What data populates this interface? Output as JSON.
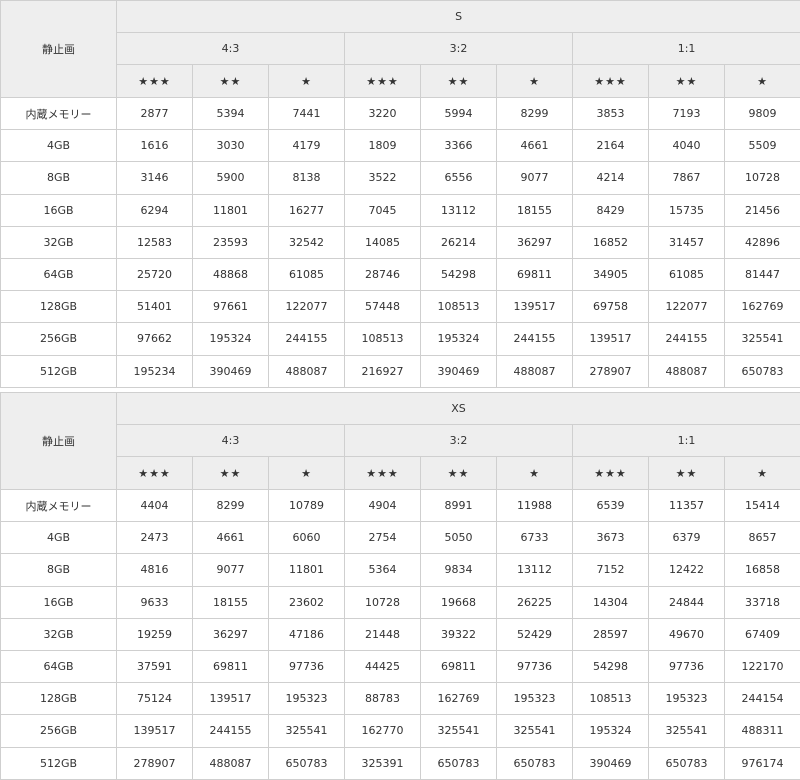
{
  "tables": [
    {
      "corner_label": "静止画",
      "size_label": "S",
      "ratios": [
        "4:3",
        "3:2",
        "1:1"
      ],
      "qualities": [
        "★★★",
        "★★",
        "★"
      ],
      "rows": [
        {
          "label": "内蔵メモリー",
          "values": [
            "2877",
            "5394",
            "7441",
            "3220",
            "5994",
            "8299",
            "3853",
            "7193",
            "9809"
          ]
        },
        {
          "label": "4GB",
          "values": [
            "1616",
            "3030",
            "4179",
            "1809",
            "3366",
            "4661",
            "2164",
            "4040",
            "5509"
          ]
        },
        {
          "label": "8GB",
          "values": [
            "3146",
            "5900",
            "8138",
            "3522",
            "6556",
            "9077",
            "4214",
            "7867",
            "10728"
          ]
        },
        {
          "label": "16GB",
          "values": [
            "6294",
            "11801",
            "16277",
            "7045",
            "13112",
            "18155",
            "8429",
            "15735",
            "21456"
          ]
        },
        {
          "label": "32GB",
          "values": [
            "12583",
            "23593",
            "32542",
            "14085",
            "26214",
            "36297",
            "16852",
            "31457",
            "42896"
          ]
        },
        {
          "label": "64GB",
          "values": [
            "25720",
            "48868",
            "61085",
            "28746",
            "54298",
            "69811",
            "34905",
            "61085",
            "81447"
          ]
        },
        {
          "label": "128GB",
          "values": [
            "51401",
            "97661",
            "122077",
            "57448",
            "108513",
            "139517",
            "69758",
            "122077",
            "162769"
          ]
        },
        {
          "label": "256GB",
          "values": [
            "97662",
            "195324",
            "244155",
            "108513",
            "195324",
            "244155",
            "139517",
            "244155",
            "325541"
          ]
        },
        {
          "label": "512GB",
          "values": [
            "195234",
            "390469",
            "488087",
            "216927",
            "390469",
            "488087",
            "278907",
            "488087",
            "650783"
          ]
        }
      ]
    },
    {
      "corner_label": "静止画",
      "size_label": "XS",
      "ratios": [
        "4:3",
        "3:2",
        "1:1"
      ],
      "qualities": [
        "★★★",
        "★★",
        "★"
      ],
      "rows": [
        {
          "label": "内蔵メモリー",
          "values": [
            "4404",
            "8299",
            "10789",
            "4904",
            "8991",
            "11988",
            "6539",
            "11357",
            "15414"
          ]
        },
        {
          "label": "4GB",
          "values": [
            "2473",
            "4661",
            "6060",
            "2754",
            "5050",
            "6733",
            "3673",
            "6379",
            "8657"
          ]
        },
        {
          "label": "8GB",
          "values": [
            "4816",
            "9077",
            "11801",
            "5364",
            "9834",
            "13112",
            "7152",
            "12422",
            "16858"
          ]
        },
        {
          "label": "16GB",
          "values": [
            "9633",
            "18155",
            "23602",
            "10728",
            "19668",
            "26225",
            "14304",
            "24844",
            "33718"
          ]
        },
        {
          "label": "32GB",
          "values": [
            "19259",
            "36297",
            "47186",
            "21448",
            "39322",
            "52429",
            "28597",
            "49670",
            "67409"
          ]
        },
        {
          "label": "64GB",
          "values": [
            "37591",
            "69811",
            "97736",
            "44425",
            "69811",
            "97736",
            "54298",
            "97736",
            "122170"
          ]
        },
        {
          "label": "128GB",
          "values": [
            "75124",
            "139517",
            "195323",
            "88783",
            "162769",
            "195323",
            "108513",
            "195323",
            "244154"
          ]
        },
        {
          "label": "256GB",
          "values": [
            "139517",
            "244155",
            "325541",
            "162770",
            "325541",
            "325541",
            "195324",
            "325541",
            "488311"
          ]
        },
        {
          "label": "512GB",
          "values": [
            "278907",
            "488087",
            "650783",
            "325391",
            "650783",
            "650783",
            "390469",
            "650783",
            "976174"
          ]
        }
      ]
    }
  ]
}
